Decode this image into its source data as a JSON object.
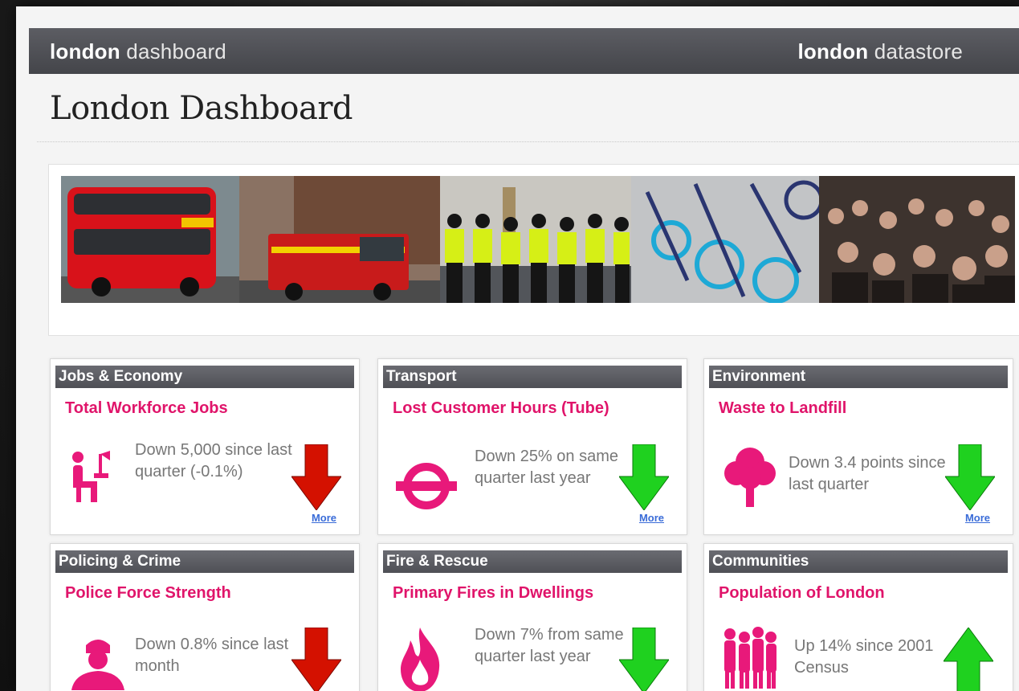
{
  "header": {
    "left_bold": "london",
    "left_thin": "dashboard",
    "right_bold": "london",
    "right_thin": "datastore"
  },
  "page_title": "London Dashboard",
  "cards": [
    {
      "section": "Jobs & Economy",
      "metric": "Total Workforce Jobs",
      "text": "Down 5,000 since last quarter (-0.1%)",
      "trend": "down",
      "trend_color": "#d41100",
      "icon": "office-worker-icon",
      "more": "More"
    },
    {
      "section": "Transport",
      "metric": "Lost Customer Hours (Tube)",
      "text": "Down 25% on same quarter last year",
      "trend": "down",
      "trend_color": "#1fd11f",
      "icon": "tube-roundel-icon",
      "more": "More"
    },
    {
      "section": "Environment",
      "metric": "Waste to Landfill",
      "text": "Down 3.4 points since last quarter",
      "trend": "down",
      "trend_color": "#1fd11f",
      "icon": "tree-icon",
      "more": "More"
    },
    {
      "section": "Policing & Crime",
      "metric": "Police Force Strength",
      "text": "Down 0.8% since last month",
      "trend": "down",
      "trend_color": "#d41100",
      "icon": "police-officer-icon"
    },
    {
      "section": "Fire & Rescue",
      "metric": "Primary Fires in Dwellings",
      "text": "Down 7% from same quarter last year",
      "trend": "down",
      "trend_color": "#1fd11f",
      "icon": "flame-icon"
    },
    {
      "section": "Communities",
      "metric": "Population of London",
      "text": "Up 14% since 2001 Census",
      "trend": "up",
      "trend_color": "#1fd11f",
      "icon": "people-group-icon"
    }
  ],
  "colors": {
    "accent_pink": "#e0146a",
    "header_bar": "#4f5056",
    "link_blue": "#3a6cd8"
  }
}
